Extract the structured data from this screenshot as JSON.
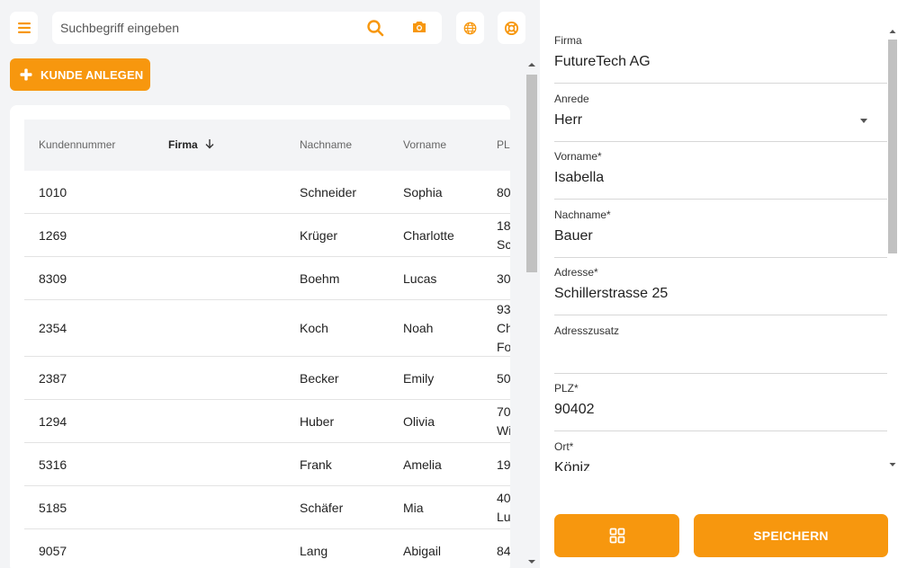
{
  "colors": {
    "accent": "#f7970e",
    "background": "#f3f4f6",
    "surface": "#ffffff"
  },
  "toolbar": {
    "menu_icon": "hamburger-icon",
    "search_placeholder": "Suchbegriff eingeben",
    "search_icon": "search-icon",
    "camera_icon": "camera-icon",
    "globe_icon": "globe-icon",
    "help_icon": "lifebuoy-icon"
  },
  "add_button": {
    "label": "KUNDE ANLEGEN",
    "icon": "plus-icon"
  },
  "table": {
    "columns": [
      {
        "label": "Kundennummer",
        "sorted": false
      },
      {
        "label": "Firma",
        "sorted": true,
        "sort_direction": "descending"
      },
      {
        "label": "Nachname",
        "sorted": false
      },
      {
        "label": "Vorname",
        "sorted": false
      },
      {
        "label": "PLZ",
        "sorted": false
      }
    ],
    "rows": [
      {
        "kundennummer": "1010",
        "firma": "",
        "nachname": "Schneider",
        "vorname": "Sophia",
        "plz": "80"
      },
      {
        "kundennummer": "1269",
        "firma": "",
        "nachname": "Krüger",
        "vorname": "Charlotte",
        "plz": "18\nSc"
      },
      {
        "kundennummer": "8309",
        "firma": "",
        "nachname": "Boehm",
        "vorname": "Lucas",
        "plz": "30"
      },
      {
        "kundennummer": "2354",
        "firma": "",
        "nachname": "Koch",
        "vorname": "Noah",
        "plz": "93\nCh\nFo"
      },
      {
        "kundennummer": "2387",
        "firma": "",
        "nachname": "Becker",
        "vorname": "Emily",
        "plz": "50"
      },
      {
        "kundennummer": "1294",
        "firma": "",
        "nachname": "Huber",
        "vorname": "Olivia",
        "plz": "70\nWi"
      },
      {
        "kundennummer": "5316",
        "firma": "",
        "nachname": "Frank",
        "vorname": "Amelia",
        "plz": "19"
      },
      {
        "kundennummer": "5185",
        "firma": "",
        "nachname": "Schäfer",
        "vorname": "Mia",
        "plz": "40\nLu"
      },
      {
        "kundennummer": "9057",
        "firma": "",
        "nachname": "Lang",
        "vorname": "Abigail",
        "plz": "84"
      }
    ]
  },
  "form": {
    "fields": [
      {
        "label": "Firma",
        "value": "FutureTech AG",
        "type": "text"
      },
      {
        "label": "Anrede",
        "value": "Herr",
        "type": "select"
      },
      {
        "label": "Vorname*",
        "value": "Isabella",
        "type": "text"
      },
      {
        "label": "Nachname*",
        "value": "Bauer",
        "type": "text"
      },
      {
        "label": "Adresse*",
        "value": "Schillerstrasse 25",
        "type": "text"
      },
      {
        "label": "Adresszusatz",
        "value": "",
        "type": "text"
      },
      {
        "label": "PLZ*",
        "value": "90402",
        "type": "text"
      },
      {
        "label": "Ort*",
        "value": "Köniz",
        "type": "text"
      }
    ],
    "grid_button_icon": "grid-icon",
    "save_label": "SPEICHERN"
  }
}
